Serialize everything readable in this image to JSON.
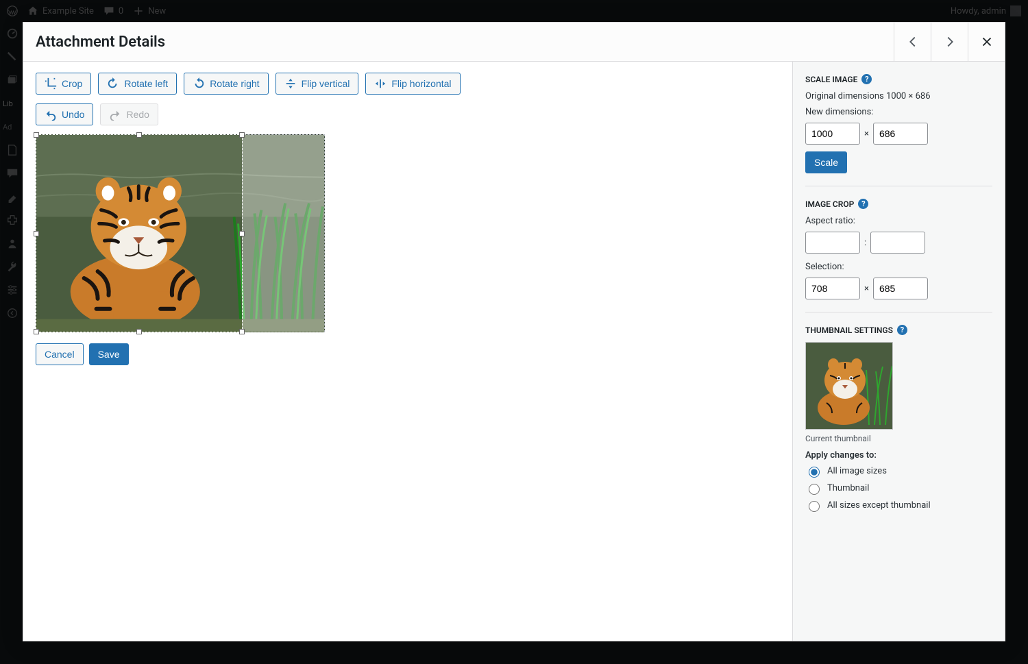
{
  "adminbar": {
    "site_name": "Example Site",
    "comments": "0",
    "new": "New",
    "howdy": "Howdy, admin"
  },
  "adminmenu": {
    "item1": "Lib",
    "item2": "Ad"
  },
  "modal": {
    "title": "Attachment Details"
  },
  "toolbar": {
    "crop": "Crop",
    "rotate_left": "Rotate left",
    "rotate_right": "Rotate right",
    "flip_v": "Flip vertical",
    "flip_h": "Flip horizontal",
    "undo": "Undo",
    "redo": "Redo",
    "cancel": "Cancel",
    "save": "Save"
  },
  "scale": {
    "title": "Scale Image",
    "orig_label": "Original dimensions 1000 × 686",
    "new_label": "New dimensions:",
    "w": "1000",
    "h": "686",
    "btn": "Scale"
  },
  "crop": {
    "title": "Image Crop",
    "aspect_label": "Aspect ratio:",
    "aspect_w": "",
    "aspect_h": "",
    "sel_label": "Selection:",
    "sel_w": "708",
    "sel_h": "685"
  },
  "thumb": {
    "title": "Thumbnail Settings",
    "caption": "Current thumbnail",
    "apply_label": "Apply changes to:",
    "opt_all": "All image sizes",
    "opt_thumb": "Thumbnail",
    "opt_except": "All sizes except thumbnail"
  }
}
